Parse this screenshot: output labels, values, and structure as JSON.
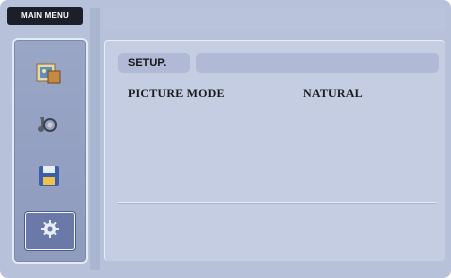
{
  "main_menu": {
    "label": "MAIN MENU"
  },
  "sidebar": {
    "items": [
      {
        "icon": "picture-icon",
        "active": false
      },
      {
        "icon": "audio-icon",
        "active": false
      },
      {
        "icon": "save-icon",
        "active": false
      },
      {
        "icon": "settings-icon",
        "active": true
      }
    ]
  },
  "panel": {
    "tab_label": "SETUP.",
    "rows": [
      {
        "label": "PICTURE MODE",
        "value": "NATURAL"
      }
    ]
  },
  "colors": {
    "frame": "#b7c2da",
    "sidebar": "#9aa6c6",
    "active_icon_bg": "#6a79a7",
    "header_tab": "#1c1f2a"
  }
}
